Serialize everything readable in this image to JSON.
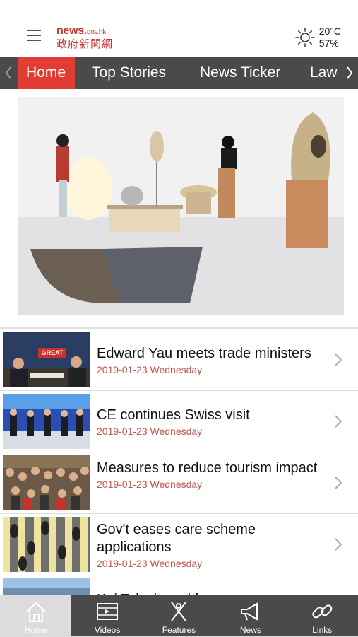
{
  "header": {
    "logo_line1": "news.",
    "logo_line1_suffix": "gov.hk",
    "logo_line2": "政府新聞網",
    "temperature": "20°C",
    "humidity": "57%"
  },
  "tabs": [
    {
      "label": "Home"
    },
    {
      "label": "Top Stories"
    },
    {
      "label": "News Ticker"
    },
    {
      "label": "Law"
    }
  ],
  "news": [
    {
      "title": "Edward Yau meets trade ministers",
      "date": "2019-01-23 Wednesday",
      "thumb_text": "GREAT"
    },
    {
      "title": "CE continues Swiss visit",
      "date": "2019-01-23 Wednesday"
    },
    {
      "title": "Measures to reduce tourism impact",
      "date": "2019-01-23 Wednesday"
    },
    {
      "title": "Gov't eases care scheme applications",
      "date": "2019-01-23 Wednesday"
    },
    {
      "title": "Kai Tak site sold",
      "date": ""
    }
  ],
  "bottom_nav": [
    {
      "label": "Home",
      "icon": "home-icon"
    },
    {
      "label": "Videos",
      "icon": "film-icon"
    },
    {
      "label": "Features",
      "icon": "features-icon"
    },
    {
      "label": "News",
      "icon": "megaphone-icon"
    },
    {
      "label": "Links",
      "icon": "link-icon"
    }
  ],
  "colors": {
    "brand_red": "#c8312c",
    "active_tab": "#e23d35",
    "nav_bg": "#4a4a4a",
    "date": "#c25550"
  }
}
